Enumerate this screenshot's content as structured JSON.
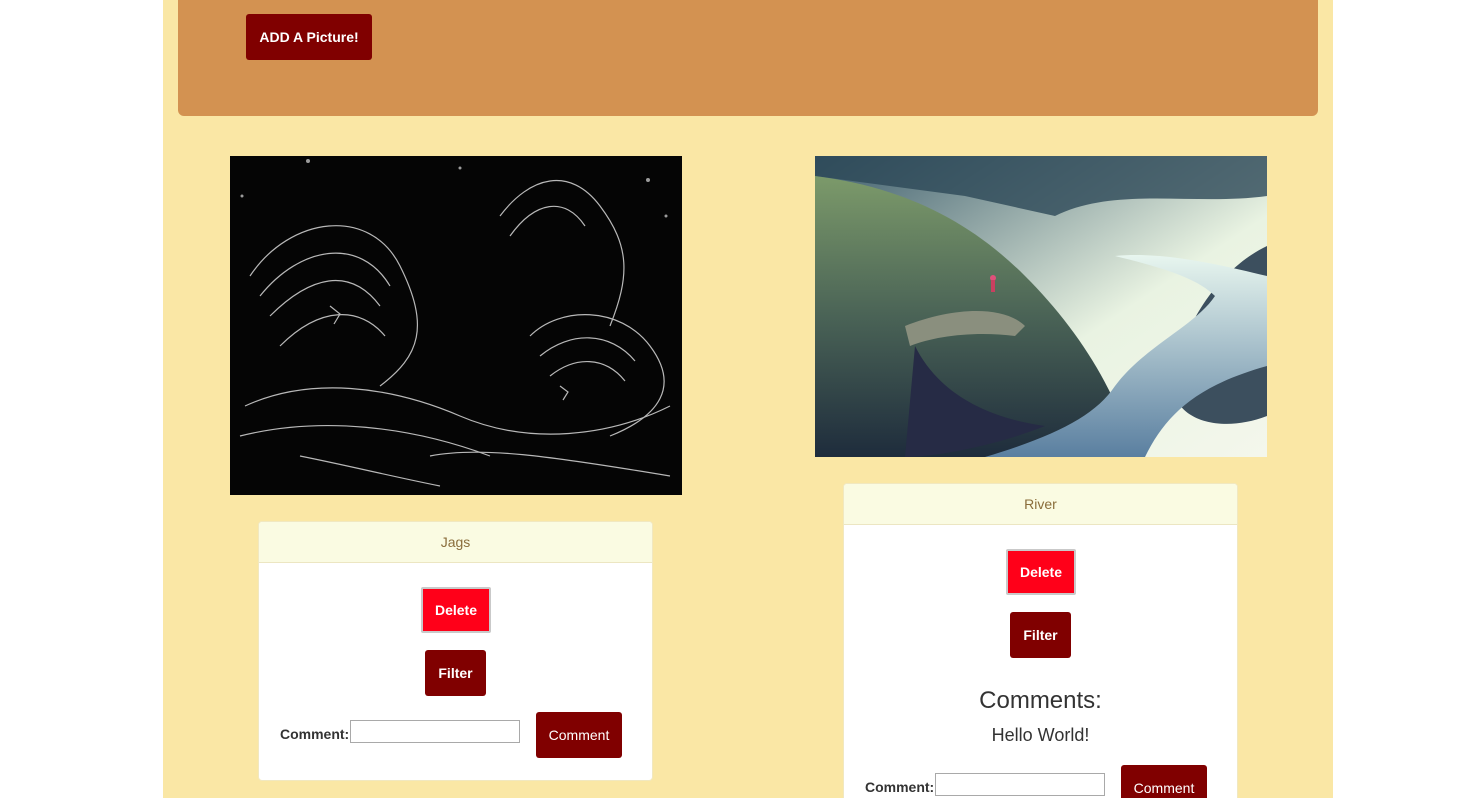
{
  "header": {
    "add_button_label": "ADD A Picture!"
  },
  "posts": [
    {
      "title": "Jags",
      "delete_label": "Delete",
      "filter_label": "Filter",
      "comment_label": "Comment:",
      "comment_value": "",
      "comment_button_label": "Comment"
    },
    {
      "title": "River",
      "delete_label": "Delete",
      "filter_label": "Filter",
      "comments_heading": "Comments:",
      "comments": [
        "Hello World!"
      ],
      "comment_label": "Comment:",
      "comment_value": "",
      "comment_button_label": "Comment"
    }
  ],
  "colors": {
    "page_background": "#fae7a5",
    "jumbotron": "#d39251",
    "dark_button": "#800000",
    "delete_button": "#ff0019",
    "panel_heading": "#fafbe2"
  }
}
